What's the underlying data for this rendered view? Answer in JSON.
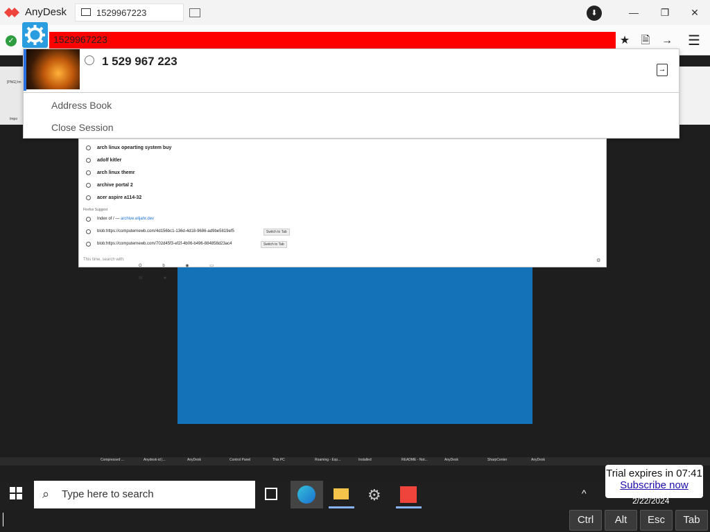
{
  "app": {
    "name": "AnyDesk",
    "tab_label": "1529967223"
  },
  "toolbar": {
    "address_value": "1529967223"
  },
  "dropdown": {
    "connection_id": "1 529 967 223",
    "items": [
      "Address Book",
      "Close Session"
    ]
  },
  "remote": {
    "suggestions": [
      "arch linux opearting system buy",
      "adolf kitler",
      "arch linux themr",
      "archive portal 2",
      "acer aspire a114-32"
    ],
    "section_label": "Firefox Suggest",
    "firefox_items": [
      {
        "text": "Index of / — ",
        "link": "archive.elijahr.dev"
      },
      {
        "text": "blob:https://computernewb.com/4d156bc1-136d-4d18-9686-ad9be5819ef5",
        "action": "Switch to Tab"
      },
      {
        "text": "blob:https://computernewb.com/702d45f3-ef2f-4b06-b496-884858d23ac4",
        "action": "Switch to Tab"
      }
    ],
    "search_with": "This time, search with:",
    "taskbar_items": [
      "Compressed ...",
      "Anydesk-id |...",
      "AnyDesk",
      "Control Panel",
      "This PC",
      "Roaming - Exp...",
      "Installed",
      "README - Not...",
      "AnyDesk",
      "SharpCenter",
      "AnyDesk"
    ],
    "tab_texts": [
      "[PNG] Im",
      "Impo"
    ]
  },
  "taskbar": {
    "search_placeholder": "Type here to search",
    "date": "2/22/2024"
  },
  "trial": {
    "line1": "Trial expires in 07:41",
    "link": "Subscribe now"
  },
  "keys": [
    "Ctrl",
    "Alt",
    "Esc",
    "Tab"
  ],
  "colors": {
    "accent_red": "#ef443b",
    "address_bg": "#ff0000",
    "remote_blue": "#1473b8"
  }
}
